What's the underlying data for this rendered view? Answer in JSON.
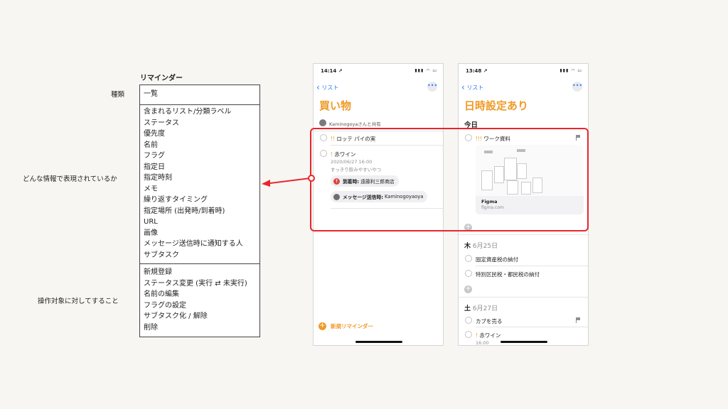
{
  "table": {
    "title": "リマインダー",
    "row_labels": {
      "kind": "種類",
      "info": "どんな情報で表現されているか",
      "ops": "操作対象に対してすること"
    },
    "kind_items": [
      "一覧"
    ],
    "info_items": [
      "含まれるリスト/分類ラベル",
      "ステータス",
      "優先度",
      "名前",
      "フラグ",
      "指定日",
      "指定時刻",
      "メモ",
      "繰り返すタイミング",
      "指定場所 (出発時/到着時)",
      "URL",
      "画像",
      "メッセージ送信時に通知する人",
      "サブタスク"
    ],
    "op_items": [
      "新規登録",
      "ステータス変更 (実行 ⇄ 未実行)",
      "名前の編集",
      "フラグの設定",
      "サブタスク化 / 解除",
      "削除"
    ]
  },
  "phone1": {
    "time": "14:14 ↗",
    "back_label": "リスト",
    "more_label": "•••",
    "title": "買い物",
    "shared_label": "Kaminogoyaさんと共有",
    "items": [
      {
        "priority": "!!",
        "name": "ロッテ パイの実"
      },
      {
        "priority": "!",
        "name": "赤ワイン",
        "datetime": "2020/06/27 16:00",
        "note": "すっきり飲みやすいやつ"
      }
    ],
    "arrival_label": "到着時:",
    "arrival_place": "遠藤利三郎商店",
    "message_label": "メッセージ送信時:",
    "message_person": "Kaminogoyaoya",
    "new_reminder": "新規リマインダー"
  },
  "phone2": {
    "time": "13:48 ↗",
    "back_label": "リスト",
    "more_label": "•••",
    "title": "日時設定あり",
    "today": "今日",
    "work_item": {
      "priority": "!!!",
      "name": "ワーク資料"
    },
    "link_title": "Figma",
    "link_url": "figma.com",
    "thu": {
      "day": "木",
      "date": "6月25日"
    },
    "thu_items": [
      "固定資産税の納付",
      "特別区民税・都民税の納付"
    ],
    "sat": {
      "day": "土",
      "date": "6月27日"
    },
    "sat_items": [
      {
        "priority": "",
        "name": "カブを売る"
      },
      {
        "priority": "!",
        "name": "赤ワイン",
        "time": "16:00"
      }
    ]
  },
  "colors": {
    "accent": "#f09a27",
    "link": "#2f7bf6",
    "highlight": "#e8262b"
  }
}
